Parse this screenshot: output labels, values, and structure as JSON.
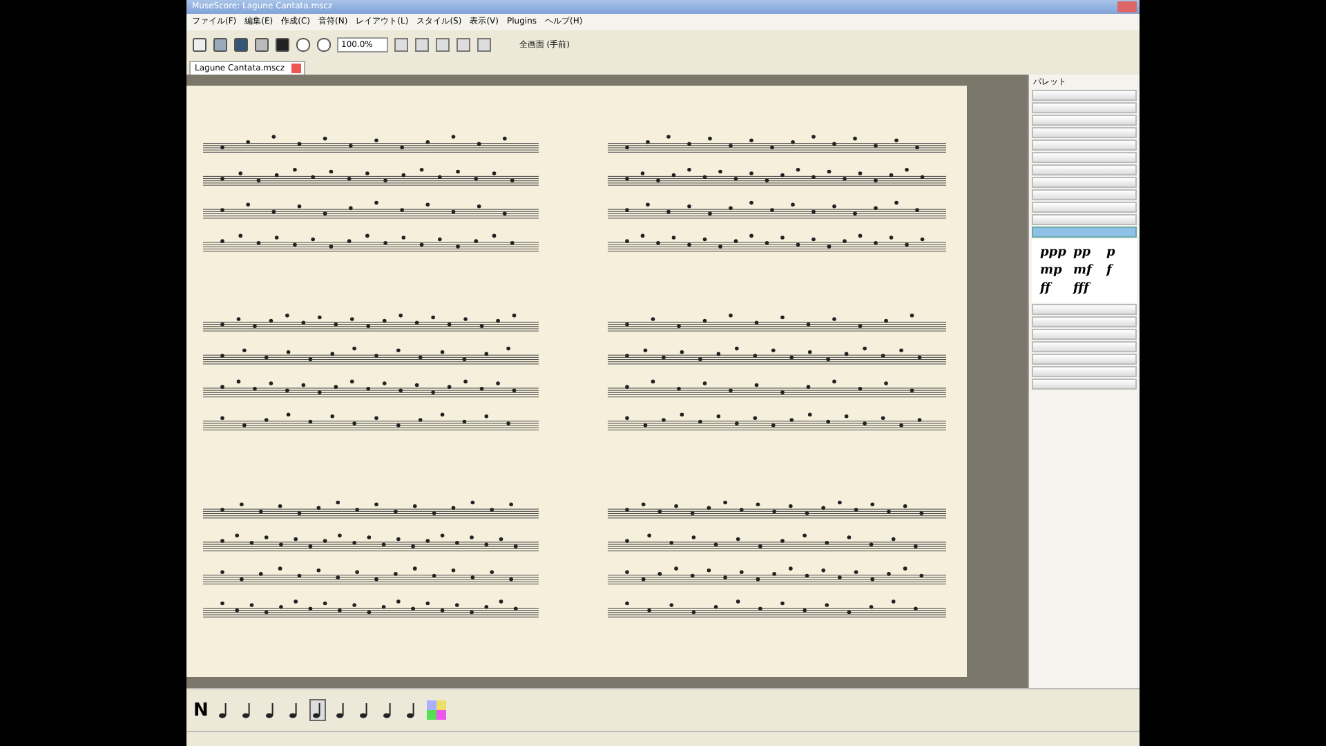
{
  "window": {
    "title": "MuseScore: Lagune Cantata.mscz"
  },
  "menu": [
    "ファイル(F)",
    "編集(E)",
    "作成(C)",
    "音符(N)",
    "レイアウト(L)",
    "スタイル(S)",
    "表示(V)",
    "Plugins",
    "ヘルプ(H)"
  ],
  "toolbar": {
    "zoom": "100.0%",
    "mode_label": "全画面 (手前)"
  },
  "tabs": [
    {
      "label": "Lagune Cantata.mscz",
      "selected": true
    }
  ],
  "palette": {
    "title": "パレット",
    "sections": [
      {
        "expanded": false
      },
      {
        "expanded": false
      },
      {
        "expanded": false
      },
      {
        "expanded": false
      },
      {
        "expanded": false
      },
      {
        "expanded": false
      },
      {
        "expanded": false
      },
      {
        "expanded": false
      },
      {
        "expanded": false
      },
      {
        "expanded": false
      },
      {
        "expanded": false
      },
      {
        "expanded": true,
        "items": [
          "ppp",
          "pp",
          "p",
          "mp",
          "mf",
          "f",
          "ff",
          "fff"
        ]
      },
      {
        "expanded": false
      },
      {
        "expanded": false
      },
      {
        "expanded": false
      },
      {
        "expanded": false
      },
      {
        "expanded": false
      },
      {
        "expanded": false
      },
      {
        "expanded": false
      }
    ]
  },
  "note_input": {
    "mode": "N",
    "durations": [
      {
        "selected": false
      },
      {
        "selected": false
      },
      {
        "selected": false
      },
      {
        "selected": false
      },
      {
        "selected": true
      },
      {
        "selected": false
      },
      {
        "selected": false
      },
      {
        "selected": false
      },
      {
        "selected": false
      }
    ]
  }
}
